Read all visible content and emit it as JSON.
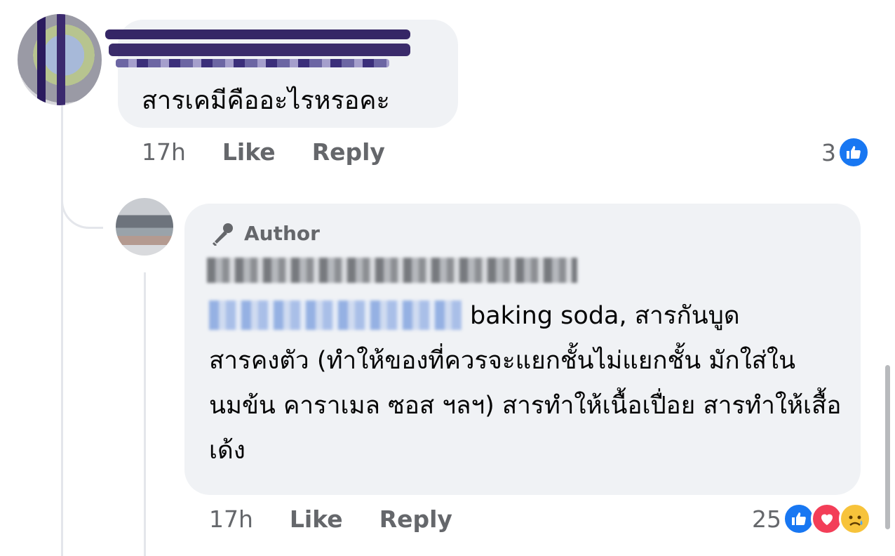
{
  "colors": {
    "bubble_bg": "#f0f2f5",
    "text_primary": "#050505",
    "text_secondary": "#65676b",
    "like_blue": "#1877f2",
    "love_red": "#f33e58",
    "sad_yellow": "#f7c33b",
    "thread_line": "#e4e6eb"
  },
  "comment1": {
    "author_name_redacted": true,
    "text": "สารเคมีคืออะไรหรอคะ",
    "time": "17h",
    "like_label": "Like",
    "reply_label": "Reply",
    "reaction_count": "3",
    "reactions": [
      "like-icon"
    ]
  },
  "reply1": {
    "badge_icon": "microphone-icon",
    "badge_label": "Author",
    "author_name_redacted": true,
    "mention_redacted": true,
    "text_first_line": "baking soda, สารกันบูด",
    "text_rest": "สารคงตัว (ทำให้ของที่ควรจะแยกชั้นไม่แยกชั้น มักใส่ในนมข้น คาราเมล ซอส ฯลฯ) สารทำให้เนื้อเปื่อย สารทำให้เสื้อเด้ง",
    "time": "17h",
    "like_label": "Like",
    "reply_label": "Reply",
    "reaction_count": "25",
    "reactions": [
      "like-icon",
      "love-icon",
      "sad-icon"
    ]
  }
}
